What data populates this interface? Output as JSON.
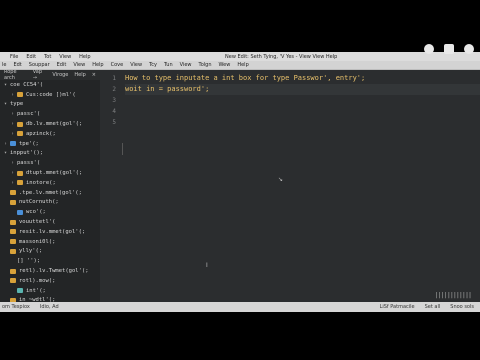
{
  "window": {
    "title": "New Edit: Seth Tying, 'V Yes - View View Help"
  },
  "menubar": {
    "items": [
      "File",
      "Edit",
      "Tot",
      "View",
      "Help"
    ],
    "right_items": [
      "View",
      "Help"
    ]
  },
  "menubar2": {
    "items": [
      "le",
      "Edt",
      "Souppar",
      "Edit",
      "View",
      "Help",
      "Cove",
      "View",
      "Tcy",
      "Tun",
      "View",
      "Tolgn",
      "Wew",
      "Help"
    ]
  },
  "sidebar": {
    "tabs": [
      "Rope arch",
      "Vap →",
      "Viroge",
      "Help"
    ],
    "close_label": "×",
    "tree": [
      {
        "label": "coe CC54'(",
        "depth": 0,
        "arrow": "▾",
        "icon": "none"
      },
      {
        "label": "Cus:code [)ml'(",
        "depth": 1,
        "arrow": "›",
        "icon": "folder"
      },
      {
        "label": "type",
        "depth": 0,
        "arrow": "▾",
        "icon": "none"
      },
      {
        "label": "passc'(",
        "depth": 1,
        "arrow": "›",
        "icon": "none"
      },
      {
        "label": "db.lv.mmet(gol'(;",
        "depth": 1,
        "arrow": "›",
        "icon": "folder"
      },
      {
        "label": "apzinck(;",
        "depth": 1,
        "arrow": "›",
        "icon": "folder"
      },
      {
        "label": "tpe'(;",
        "depth": 0,
        "arrow": "›",
        "icon": "blue"
      },
      {
        "label": "inpput'();",
        "depth": 0,
        "arrow": "▾",
        "icon": "none"
      },
      {
        "label": "passs'(",
        "depth": 1,
        "arrow": "›",
        "icon": "none"
      },
      {
        "label": "dtupt.mmet(gol'(;",
        "depth": 1,
        "arrow": "›",
        "icon": "folder"
      },
      {
        "label": "inotore(;",
        "depth": 1,
        "arrow": "›",
        "icon": "folder"
      },
      {
        "label": ".tpe.lv.mmet(gol'(;",
        "depth": 0,
        "arrow": "",
        "icon": "folder"
      },
      {
        "label": "nutCornuth(;",
        "depth": 0,
        "arrow": "",
        "icon": "folder"
      },
      {
        "label": "wco'(;",
        "depth": 1,
        "arrow": "",
        "icon": "blue"
      },
      {
        "label": "vouuttetl'(",
        "depth": 0,
        "arrow": "",
        "icon": "folder"
      },
      {
        "label": "resit.lv.mmet(gol'(;",
        "depth": 0,
        "arrow": "",
        "icon": "folder"
      },
      {
        "label": "massoni0l(;",
        "depth": 0,
        "arrow": "",
        "icon": "folder"
      },
      {
        "label": "ylly'(;",
        "depth": 0,
        "arrow": "",
        "icon": "folder"
      },
      {
        "label": "[] '');",
        "depth": 1,
        "arrow": "",
        "icon": "none"
      },
      {
        "label": "retl).lv.Twmet(gol'(;",
        "depth": 0,
        "arrow": "",
        "icon": "folder"
      },
      {
        "label": "rotl).mow(;",
        "depth": 0,
        "arrow": "",
        "icon": "folder"
      },
      {
        "label": "int'(;",
        "depth": 1,
        "arrow": "",
        "icon": "teal"
      },
      {
        "label": "in ~wdtl'(;",
        "depth": 0,
        "arrow": "",
        "icon": "folder"
      }
    ]
  },
  "editor": {
    "line_numbers": [
      "1",
      "2",
      "3",
      "4",
      "5"
    ],
    "lines": [
      "How to type inputate a int box for type Passwor', entry';",
      "woit in = password';",
      "",
      "",
      ""
    ]
  },
  "statusbar": {
    "left": [
      "om Tespiox",
      "Idio, Ad"
    ],
    "right": [
      "LiSf Patmacile",
      "Set all",
      "Snoo sols"
    ]
  },
  "decor": {
    "ticks": "||||||||||||"
  }
}
